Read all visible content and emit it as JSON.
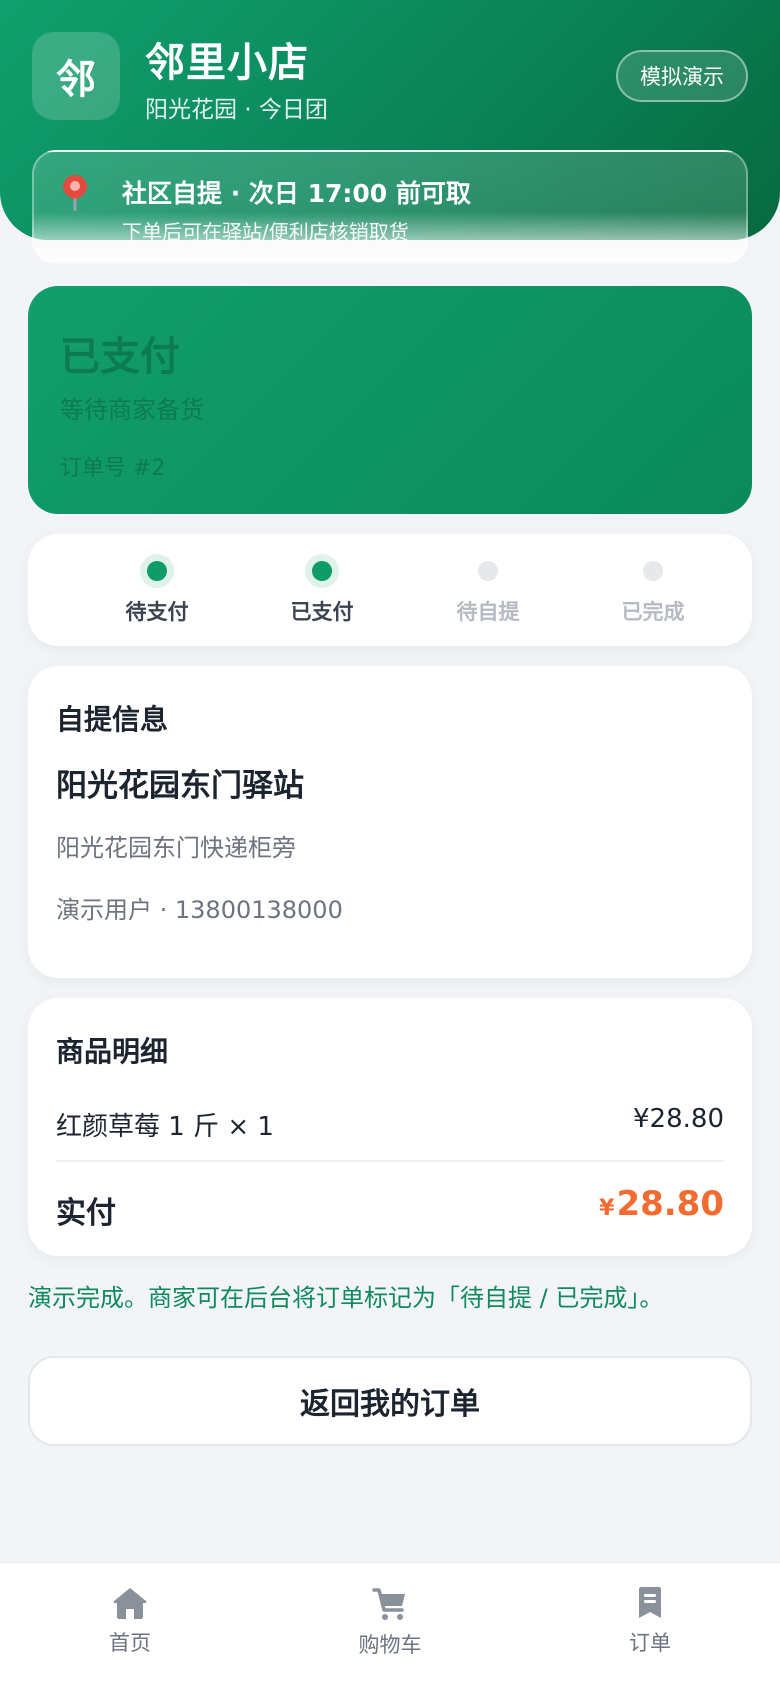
{
  "header": {
    "logo_char": "邻",
    "store_name": "邻里小店",
    "store_sub": "阳光花园 · 今日团",
    "demo_button": "模拟演示"
  },
  "pickup_banner": {
    "icon": "map-pin-icon",
    "title": "社区自提 · 次日 17:00 前可取",
    "desc": "下单后可在驿站/便利店核销取货"
  },
  "status": {
    "title": "已支付",
    "subtitle": "等待商家备货",
    "order_no": "订单号 #2"
  },
  "steps": [
    {
      "label": "待支付",
      "state": "done"
    },
    {
      "label": "已支付",
      "state": "done"
    },
    {
      "label": "待自提",
      "state": "todo"
    },
    {
      "label": "已完成",
      "state": "todo"
    }
  ],
  "pickup_info": {
    "title": "自提信息",
    "station": "阳光花园东门驿站",
    "address": "阳光花园东门快递柜旁",
    "contact": "演示用户 · 13800138000"
  },
  "goods": {
    "title": "商品明细",
    "items": [
      {
        "name": "红颜草莓 1 斤 × 1",
        "price": "¥28.80"
      }
    ],
    "paid_label": "实付",
    "paid_symbol": "¥",
    "paid_amount": "28.80"
  },
  "notice": "演示完成。商家可在后台将订单标记为「待自提 / 已完成」。",
  "back_button": "返回我的订单",
  "tabbar": [
    {
      "label": "首页",
      "icon": "home-icon"
    },
    {
      "label": "购物车",
      "icon": "cart-icon"
    },
    {
      "label": "订单",
      "icon": "order-icon"
    }
  ],
  "colors": {
    "brand": "#0f9c68",
    "price": "#f26b31",
    "inactive": "#b5bac3"
  }
}
